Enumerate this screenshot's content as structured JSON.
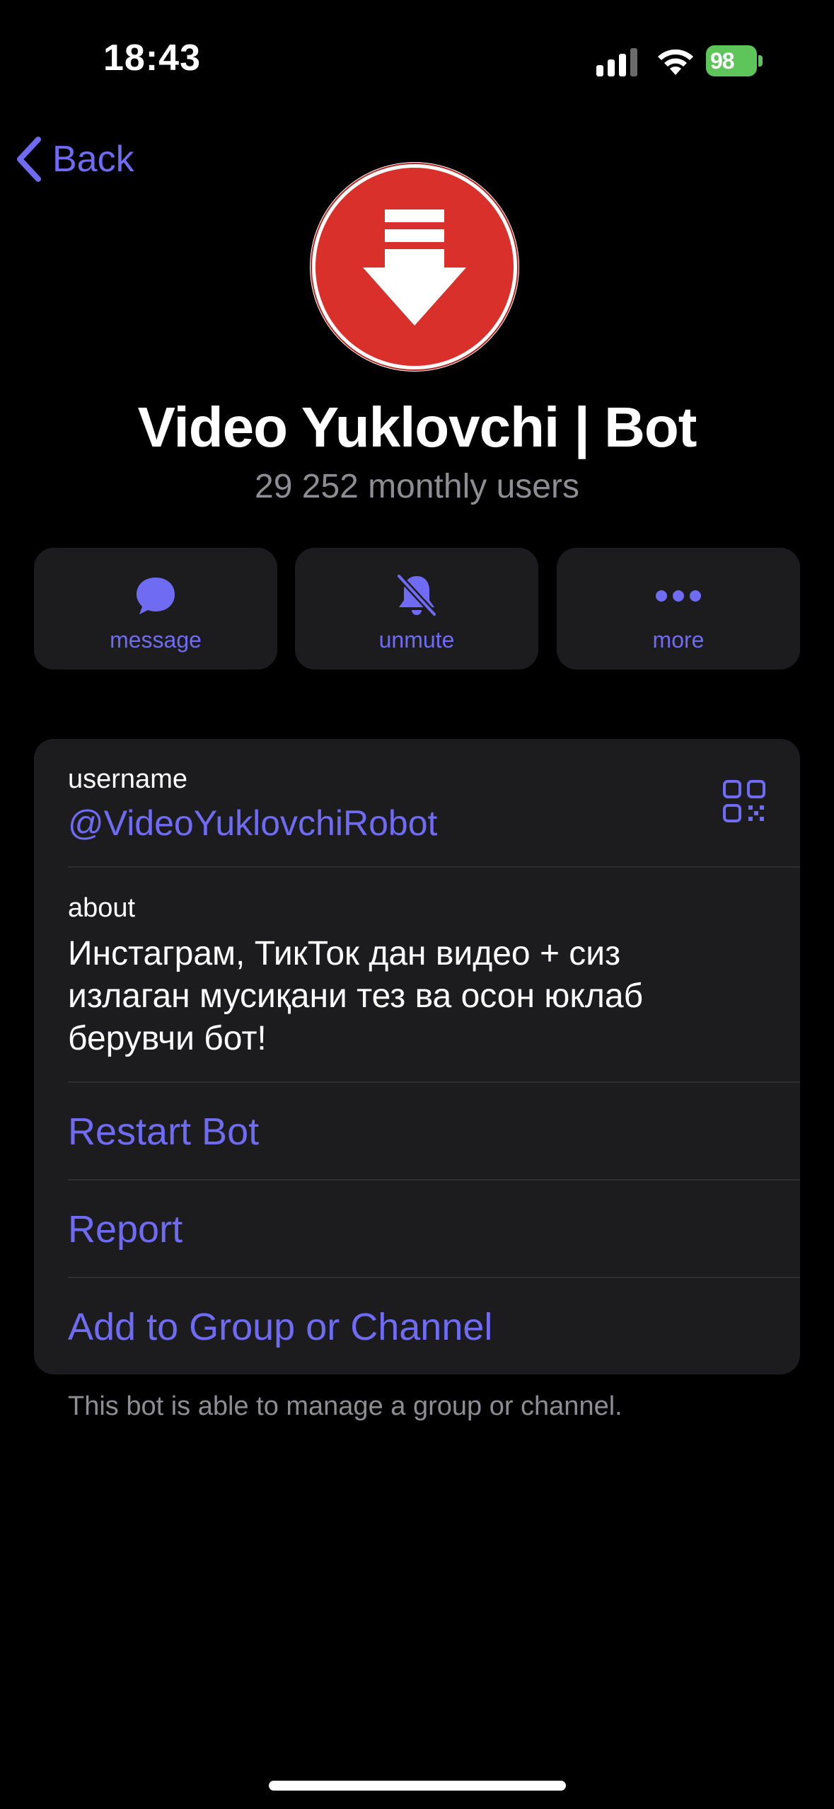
{
  "status_bar": {
    "time": "18:43",
    "battery": "98"
  },
  "nav": {
    "back_label": "Back"
  },
  "profile": {
    "name": "Video Yuklovchi | Bot",
    "subtitle": "29 252 monthly users"
  },
  "actions": [
    {
      "label": "message",
      "icon": "chat-bubble-icon"
    },
    {
      "label": "unmute",
      "icon": "bell-slash-icon"
    },
    {
      "label": "more",
      "icon": "ellipsis-icon"
    }
  ],
  "info": {
    "username_label": "username",
    "username_value": "@VideoYuklovchiRobot",
    "about_label": "about",
    "about_value": "Инстаграм, ТикТок дан видео + сиз излаган мусиқани тез ва осон юклаб берувчи бот!",
    "restart": "Restart Bot",
    "report": "Report",
    "add_group": "Add to Group or Channel"
  },
  "footnote": "This bot is able to manage a group or channel.",
  "colors": {
    "accent": "#6f6bf2",
    "card": "#1c1c1e",
    "background": "#000000",
    "avatar_red": "#d9302b"
  }
}
